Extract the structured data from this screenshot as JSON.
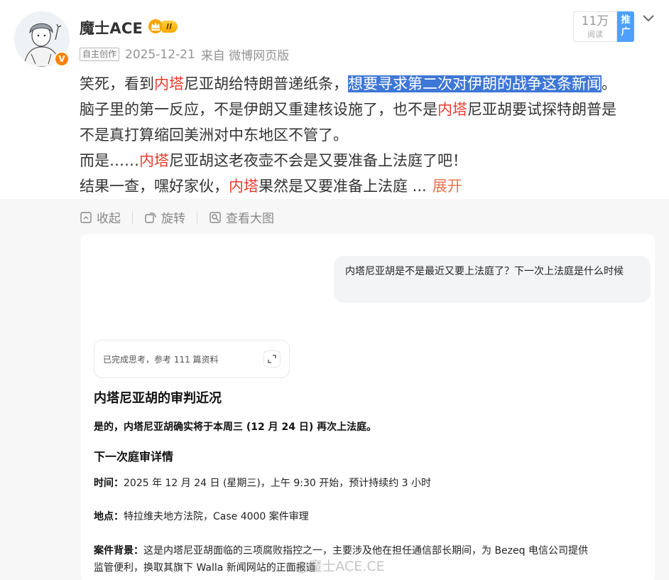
{
  "header": {
    "username": "魔士ACE",
    "level_badge": "II",
    "tag": "自主创作",
    "date": "2025-12-21",
    "source": "来自 微博网页版",
    "reads_count": "11万",
    "reads_label": "阅读",
    "promo_label": "推广",
    "avatar": "avatar-icon",
    "verified_badge": "v-badge-icon"
  },
  "post": {
    "l1a": "笑死，看到",
    "l1b": "内塔",
    "l1c": "尼亚胡给特朗普递纸条，",
    "l1d": "想要寻求第二次对伊朗的战争这条新闻",
    "l1e": "。",
    "l2a": "脑子里的第一反应，不是伊朗又重建核设施了，也不是",
    "l2b": "内塔",
    "l2c": "尼亚胡要试探特朗普是",
    "l3": "不是真打算缩回美洲对中东地区不管了。",
    "l4a": "而是……",
    "l4b": "内塔",
    "l4c": "尼亚胡这老夜壶不会是又要准备上法庭了吧！",
    "l5a": "结果一查，嘿好家伙，",
    "l5b": "内塔",
    "l5c": "果然是又要准备上法庭",
    "ellipsis": " ...",
    "expand": "展开"
  },
  "actions": {
    "collapse": "收起",
    "rotate": "旋转",
    "view_large": "查看大图"
  },
  "chat": {
    "question": "内塔尼亚胡是不是最近又要上法庭了？下一次上法庭是什么时候",
    "thinking": "已完成思考，参考 111 篇资料",
    "title": "内塔尼亚胡的审判近况",
    "answer": "是的，内塔尼亚胡确实将于本周三 (12 月 24 日) 再次上法庭。",
    "subtitle": "下一次庭审详情",
    "time_label": "时间：",
    "time_value": "2025 年 12 月 24 日 (星期三)，上午 9:30 开始，预计持续约 3 小时",
    "place_label": "地点：",
    "place_value": "特拉维夫地方法院，Case 4000 案件审理",
    "bg_label": "案件背景：",
    "bg_value_1": "这是内塔尼亚胡面临的三项腐败指控之一，主要涉及他在担任通信部长期间，为 Bezeq 电信公司提供",
    "bg_value_2": "监管便利，换取其旗下 Walla 新闻网站的正面报道",
    "watermark": "@魔士ACE.CE"
  },
  "colors": {
    "highlight": "#eb3a2c",
    "selection": "#3e77d6",
    "expand": "#eb7350",
    "promo": "#4ea0ff",
    "verified": "#ff8200"
  }
}
